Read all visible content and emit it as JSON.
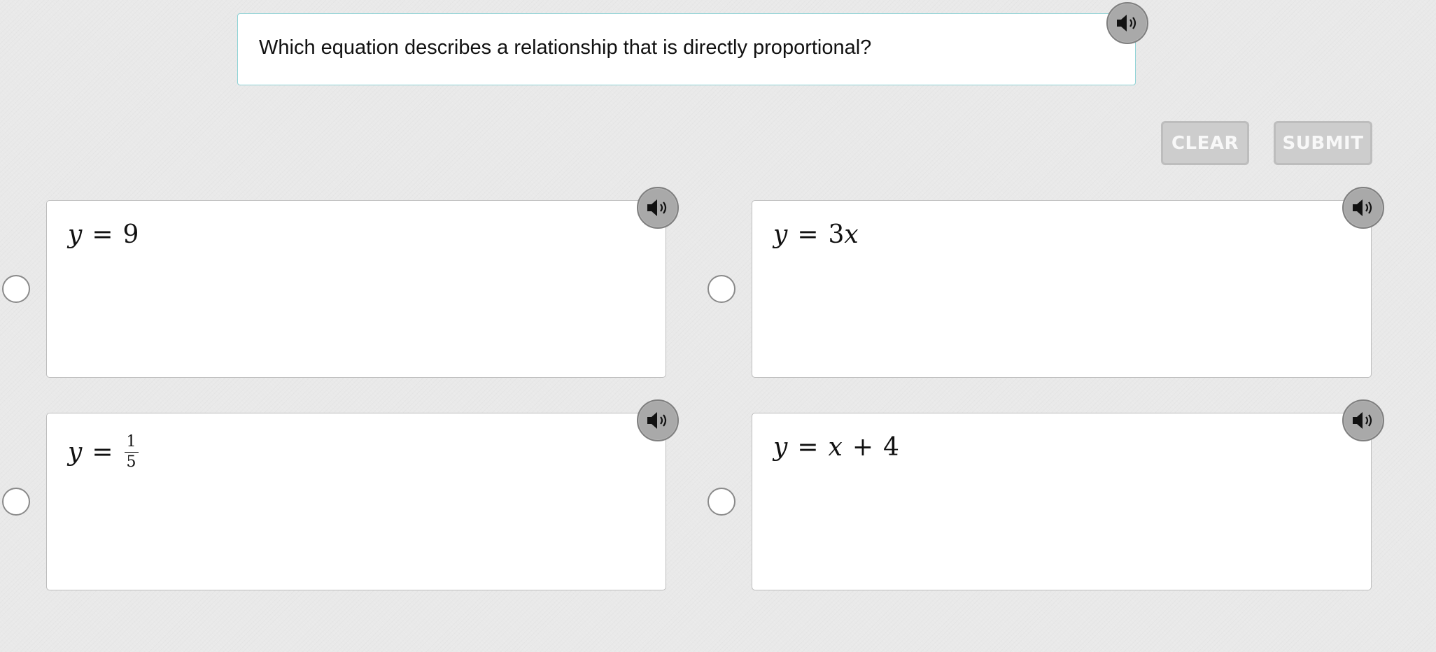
{
  "question": {
    "text": "Which equation describes a relationship that is directly proportional?",
    "audio_icon": "speaker-icon"
  },
  "actions": {
    "clear_label": "CLEAR",
    "submit_label": "SUBMIT"
  },
  "options": [
    {
      "lhs": "y",
      "eq": "=",
      "rhs": "9",
      "audio_icon": "speaker-icon"
    },
    {
      "lhs": "y",
      "eq": "=",
      "rhs": "3x",
      "audio_icon": "speaker-icon"
    },
    {
      "lhs": "y",
      "eq": "=",
      "frac_num": "1",
      "frac_den": "5",
      "audio_icon": "speaker-icon"
    },
    {
      "lhs": "y",
      "eq": "=",
      "rhs_var": "x",
      "plus": "+",
      "rhs_const": "4",
      "audio_icon": "speaker-icon"
    }
  ],
  "colors": {
    "background": "#e9e9e9",
    "question_border": "#8fd3d6",
    "button_disabled": "#cdcdcd",
    "audio_button": "#a9a9a9"
  }
}
